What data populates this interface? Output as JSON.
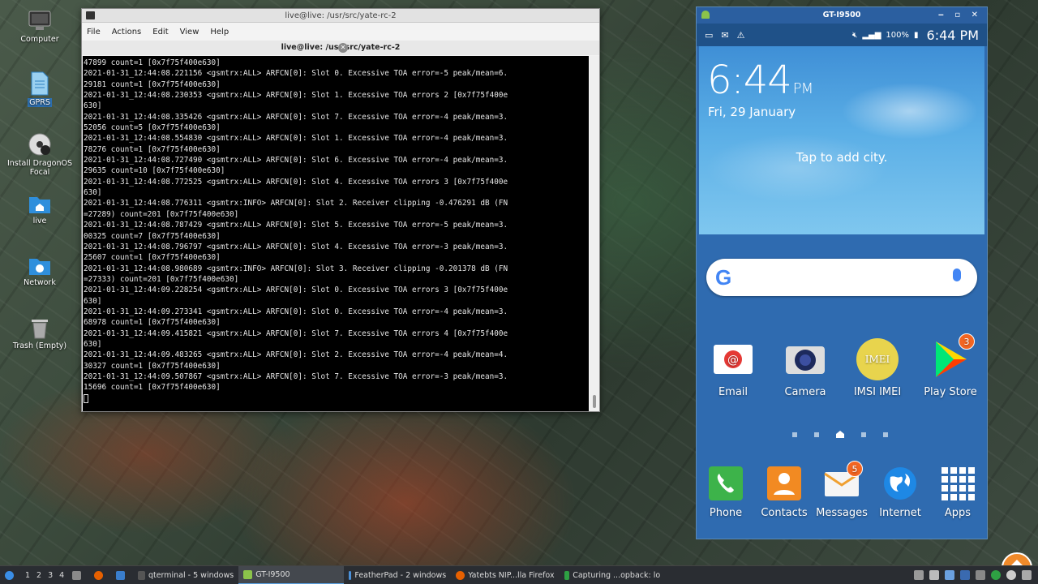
{
  "desktop": {
    "icons": [
      {
        "label": "Computer",
        "icon": "computer-icon"
      },
      {
        "label": "GPRS",
        "icon": "text-file-icon"
      },
      {
        "label": "Install DragonOS Focal",
        "icon": "installer-disc-icon"
      },
      {
        "label": "live",
        "icon": "home-folder-icon"
      },
      {
        "label": "Network",
        "icon": "network-folder-icon"
      },
      {
        "label": "Trash (Empty)",
        "icon": "trash-icon"
      }
    ]
  },
  "terminal": {
    "window_title": "live@live: /usr/src/yate-rc-2",
    "menu": [
      "File",
      "Actions",
      "Edit",
      "View",
      "Help"
    ],
    "tab_title": "live@live: /usr/src/yate-rc-2",
    "lines": [
      "47899 count=1 [0x7f75f400e630]",
      "2021-01-31_12:44:08.221156 <gsmtrx:ALL> ARFCN[0]: Slot 0. Excessive TOA error=-5 peak/mean=6.",
      "29181 count=1 [0x7f75f400e630]",
      "2021-01-31_12:44:08.230353 <gsmtrx:ALL> ARFCN[0]: Slot 1. Excessive TOA errors 2 [0x7f75f400e",
      "630]",
      "2021-01-31_12:44:08.335426 <gsmtrx:ALL> ARFCN[0]: Slot 7. Excessive TOA error=-4 peak/mean=3.",
      "52056 count=5 [0x7f75f400e630]",
      "2021-01-31_12:44:08.554830 <gsmtrx:ALL> ARFCN[0]: Slot 1. Excessive TOA error=-4 peak/mean=3.",
      "78276 count=1 [0x7f75f400e630]",
      "2021-01-31_12:44:08.727490 <gsmtrx:ALL> ARFCN[0]: Slot 6. Excessive TOA error=-4 peak/mean=3.",
      "29635 count=10 [0x7f75f400e630]",
      "2021-01-31_12:44:08.772525 <gsmtrx:ALL> ARFCN[0]: Slot 4. Excessive TOA errors 3 [0x7f75f400e",
      "630]",
      "2021-01-31_12:44:08.776311 <gsmtrx:INFO> ARFCN[0]: Slot 2. Receiver clipping -0.476291 dB (FN",
      "=27289) count=201 [0x7f75f400e630]",
      "2021-01-31_12:44:08.787429 <gsmtrx:ALL> ARFCN[0]: Slot 5. Excessive TOA error=-5 peak/mean=3.",
      "00325 count=7 [0x7f75f400e630]",
      "2021-01-31_12:44:08.796797 <gsmtrx:ALL> ARFCN[0]: Slot 4. Excessive TOA error=-3 peak/mean=3.",
      "25607 count=1 [0x7f75f400e630]",
      "2021-01-31_12:44:08.980689 <gsmtrx:INFO> ARFCN[0]: Slot 3. Receiver clipping -0.201378 dB (FN",
      "=27333) count=201 [0x7f75f400e630]",
      "2021-01-31_12:44:09.228254 <gsmtrx:ALL> ARFCN[0]: Slot 0. Excessive TOA errors 3 [0x7f75f400e",
      "630]",
      "2021-01-31_12:44:09.273341 <gsmtrx:ALL> ARFCN[0]: Slot 0. Excessive TOA error=-4 peak/mean=3.",
      "68978 count=1 [0x7f75f400e630]",
      "2021-01-31_12:44:09.415821 <gsmtrx:ALL> ARFCN[0]: Slot 7. Excessive TOA errors 4 [0x7f75f400e",
      "630]",
      "2021-01-31_12:44:09.483265 <gsmtrx:ALL> ARFCN[0]: Slot 2. Excessive TOA error=-4 peak/mean=4.",
      "30327 count=1 [0x7f75f400e630]",
      "2021-01-31_12:44:09.507867 <gsmtrx:ALL> ARFCN[0]: Slot 7. Excessive TOA error=-3 peak/mean=3.",
      "15696 count=1 [0x7f75f400e630]"
    ]
  },
  "phone": {
    "window_title": "GT-I9500",
    "status": {
      "battery": "100%",
      "time": "6:44 PM"
    },
    "clock": {
      "time": "6:44",
      "ampm": "PM"
    },
    "date": "Fri, 29 January",
    "weather_prompt": "Tap to add city.",
    "apps_row1": [
      {
        "label": "Email",
        "icon": "email-icon"
      },
      {
        "label": "Camera",
        "icon": "camera-icon"
      },
      {
        "label": "IMSI IMEI",
        "icon": "imsi-imei-icon",
        "glyph": "IMEI"
      },
      {
        "label": "Play Store",
        "icon": "play-store-icon",
        "badge": "3"
      }
    ],
    "dock": [
      {
        "label": "Phone",
        "icon": "phone-icon"
      },
      {
        "label": "Contacts",
        "icon": "contacts-icon"
      },
      {
        "label": "Messages",
        "icon": "messages-icon",
        "badge": "5"
      },
      {
        "label": "Internet",
        "icon": "internet-globe-icon"
      },
      {
        "label": "Apps",
        "icon": "apps-grid-icon"
      }
    ]
  },
  "taskbar": {
    "workspaces": [
      "1",
      "2",
      "3",
      "4"
    ],
    "items": [
      {
        "label": "qterminal - 5 windows"
      },
      {
        "label": "GT-I9500"
      },
      {
        "label": "FeatherPad - 2 windows"
      },
      {
        "label": "Yatebts NIP...lla Firefox"
      },
      {
        "label": "Capturing ...opback: lo"
      }
    ]
  }
}
